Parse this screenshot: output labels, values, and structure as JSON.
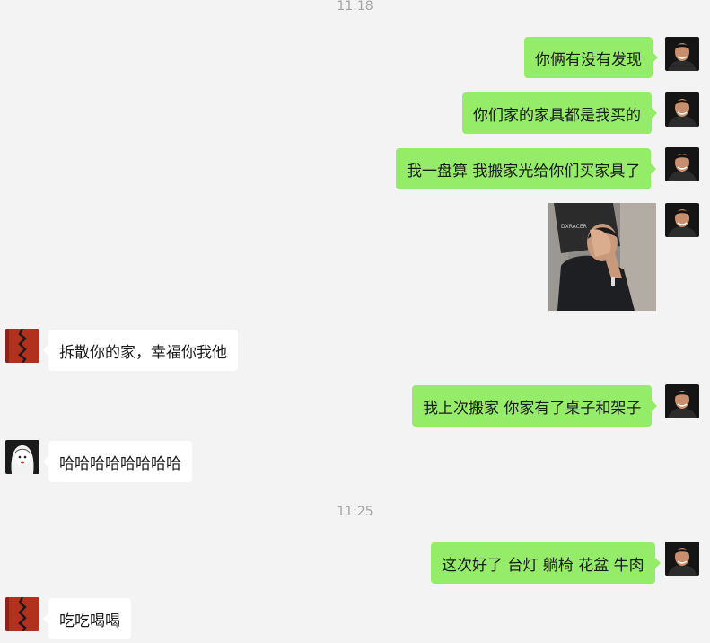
{
  "chat": {
    "timestamps": [
      "11:18",
      "11:25"
    ],
    "messages": [
      {
        "from": "me",
        "type": "text",
        "text": "你俩有没有发现"
      },
      {
        "from": "me",
        "type": "text",
        "text": "你们家的家具都是我买的"
      },
      {
        "from": "me",
        "type": "text",
        "text": "我一盘算 我搬家光给你们买家具了"
      },
      {
        "from": "me",
        "type": "image",
        "caption": "DXRACER"
      },
      {
        "from": "friend_a",
        "type": "text",
        "text": "拆散你的家，幸福你我他"
      },
      {
        "from": "me",
        "type": "text",
        "text": "我上次搬家 你家有了桌子和架子"
      },
      {
        "from": "friend_b",
        "type": "text",
        "text": "哈哈哈哈哈哈哈哈"
      },
      {
        "from": "me",
        "type": "text",
        "text": "这次好了 台灯 躺椅 花盆 牛肉"
      },
      {
        "from": "friend_a",
        "type": "text",
        "text": "吃吃喝喝"
      }
    ]
  },
  "colors": {
    "background": "#f3f3f3",
    "my_bubble": "#95ec69",
    "other_bubble": "#ffffff",
    "timestamp": "#a4a4a4"
  },
  "icons": {
    "my_avatar": "man-portrait-avatar",
    "friend_a_avatar": "red-pattern-avatar",
    "friend_b_avatar": "anime-girl-avatar"
  }
}
